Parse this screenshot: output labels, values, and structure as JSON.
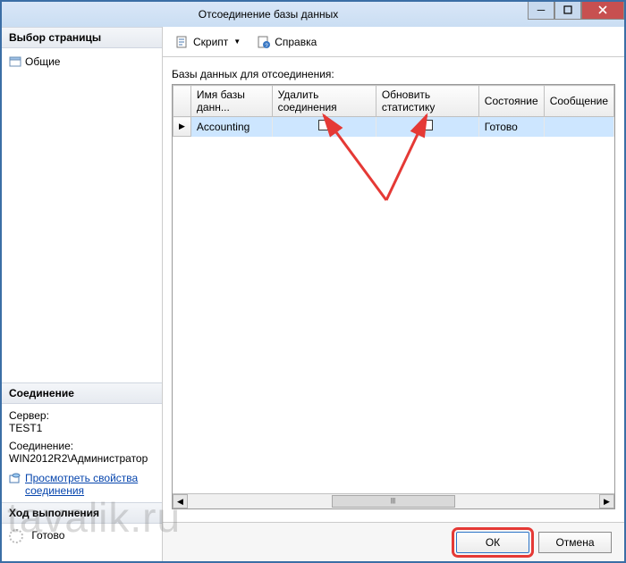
{
  "window": {
    "title": "Отсоединение базы данных"
  },
  "titlebar_buttons": {
    "minimize": "–",
    "maximize": "□",
    "close": "X"
  },
  "left": {
    "page_selection_header": "Выбор страницы",
    "nav_general": "Общие",
    "connection_header": "Соединение",
    "server_label": "Сервер:",
    "server_value": "TEST1",
    "connection_label": "Соединение:",
    "connection_value": "WIN2012R2\\Администратор",
    "view_props_link_l1": "Просмотреть свойства",
    "view_props_link_l2": "соединения",
    "progress_header": "Ход выполнения",
    "progress_status": "Готово"
  },
  "toolbar": {
    "script_label": "Скрипт",
    "help_label": "Справка"
  },
  "grid": {
    "label": "Базы данных для отсоединения:",
    "columns": {
      "name": "Имя базы данн...",
      "drop_conn": "Удалить соединения",
      "update_stats": "Обновить статистику",
      "state": "Состояние",
      "message": "Сообщение"
    },
    "rows": [
      {
        "name": "Accounting",
        "drop_conn": false,
        "update_stats": false,
        "state": "Готово",
        "message": ""
      }
    ]
  },
  "buttons": {
    "ok": "ОК",
    "cancel": "Отмена"
  },
  "watermark": "tavalik.ru"
}
